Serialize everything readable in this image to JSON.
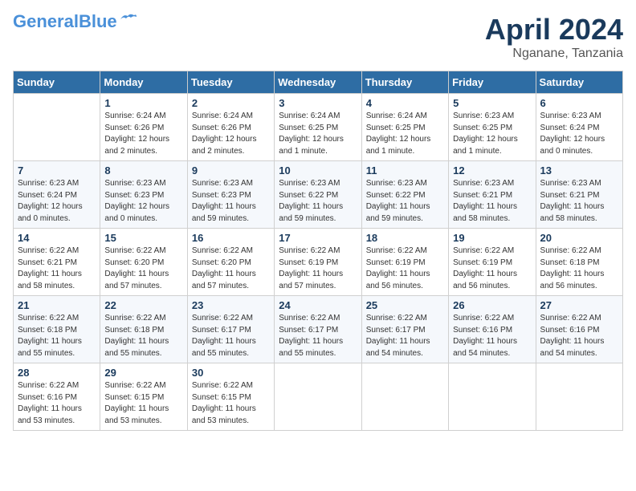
{
  "logo": {
    "line1": "General",
    "line2": "Blue"
  },
  "header": {
    "month": "April 2024",
    "location": "Nganane, Tanzania"
  },
  "weekdays": [
    "Sunday",
    "Monday",
    "Tuesday",
    "Wednesday",
    "Thursday",
    "Friday",
    "Saturday"
  ],
  "weeks": [
    [
      {
        "day": "",
        "info": ""
      },
      {
        "day": "1",
        "info": "Sunrise: 6:24 AM\nSunset: 6:26 PM\nDaylight: 12 hours\nand 2 minutes."
      },
      {
        "day": "2",
        "info": "Sunrise: 6:24 AM\nSunset: 6:26 PM\nDaylight: 12 hours\nand 2 minutes."
      },
      {
        "day": "3",
        "info": "Sunrise: 6:24 AM\nSunset: 6:25 PM\nDaylight: 12 hours\nand 1 minute."
      },
      {
        "day": "4",
        "info": "Sunrise: 6:24 AM\nSunset: 6:25 PM\nDaylight: 12 hours\nand 1 minute."
      },
      {
        "day": "5",
        "info": "Sunrise: 6:23 AM\nSunset: 6:25 PM\nDaylight: 12 hours\nand 1 minute."
      },
      {
        "day": "6",
        "info": "Sunrise: 6:23 AM\nSunset: 6:24 PM\nDaylight: 12 hours\nand 0 minutes."
      }
    ],
    [
      {
        "day": "7",
        "info": "Sunrise: 6:23 AM\nSunset: 6:24 PM\nDaylight: 12 hours\nand 0 minutes."
      },
      {
        "day": "8",
        "info": "Sunrise: 6:23 AM\nSunset: 6:23 PM\nDaylight: 12 hours\nand 0 minutes."
      },
      {
        "day": "9",
        "info": "Sunrise: 6:23 AM\nSunset: 6:23 PM\nDaylight: 11 hours\nand 59 minutes."
      },
      {
        "day": "10",
        "info": "Sunrise: 6:23 AM\nSunset: 6:22 PM\nDaylight: 11 hours\nand 59 minutes."
      },
      {
        "day": "11",
        "info": "Sunrise: 6:23 AM\nSunset: 6:22 PM\nDaylight: 11 hours\nand 59 minutes."
      },
      {
        "day": "12",
        "info": "Sunrise: 6:23 AM\nSunset: 6:21 PM\nDaylight: 11 hours\nand 58 minutes."
      },
      {
        "day": "13",
        "info": "Sunrise: 6:23 AM\nSunset: 6:21 PM\nDaylight: 11 hours\nand 58 minutes."
      }
    ],
    [
      {
        "day": "14",
        "info": "Sunrise: 6:22 AM\nSunset: 6:21 PM\nDaylight: 11 hours\nand 58 minutes."
      },
      {
        "day": "15",
        "info": "Sunrise: 6:22 AM\nSunset: 6:20 PM\nDaylight: 11 hours\nand 57 minutes."
      },
      {
        "day": "16",
        "info": "Sunrise: 6:22 AM\nSunset: 6:20 PM\nDaylight: 11 hours\nand 57 minutes."
      },
      {
        "day": "17",
        "info": "Sunrise: 6:22 AM\nSunset: 6:19 PM\nDaylight: 11 hours\nand 57 minutes."
      },
      {
        "day": "18",
        "info": "Sunrise: 6:22 AM\nSunset: 6:19 PM\nDaylight: 11 hours\nand 56 minutes."
      },
      {
        "day": "19",
        "info": "Sunrise: 6:22 AM\nSunset: 6:19 PM\nDaylight: 11 hours\nand 56 minutes."
      },
      {
        "day": "20",
        "info": "Sunrise: 6:22 AM\nSunset: 6:18 PM\nDaylight: 11 hours\nand 56 minutes."
      }
    ],
    [
      {
        "day": "21",
        "info": "Sunrise: 6:22 AM\nSunset: 6:18 PM\nDaylight: 11 hours\nand 55 minutes."
      },
      {
        "day": "22",
        "info": "Sunrise: 6:22 AM\nSunset: 6:18 PM\nDaylight: 11 hours\nand 55 minutes."
      },
      {
        "day": "23",
        "info": "Sunrise: 6:22 AM\nSunset: 6:17 PM\nDaylight: 11 hours\nand 55 minutes."
      },
      {
        "day": "24",
        "info": "Sunrise: 6:22 AM\nSunset: 6:17 PM\nDaylight: 11 hours\nand 55 minutes."
      },
      {
        "day": "25",
        "info": "Sunrise: 6:22 AM\nSunset: 6:17 PM\nDaylight: 11 hours\nand 54 minutes."
      },
      {
        "day": "26",
        "info": "Sunrise: 6:22 AM\nSunset: 6:16 PM\nDaylight: 11 hours\nand 54 minutes."
      },
      {
        "day": "27",
        "info": "Sunrise: 6:22 AM\nSunset: 6:16 PM\nDaylight: 11 hours\nand 54 minutes."
      }
    ],
    [
      {
        "day": "28",
        "info": "Sunrise: 6:22 AM\nSunset: 6:16 PM\nDaylight: 11 hours\nand 53 minutes."
      },
      {
        "day": "29",
        "info": "Sunrise: 6:22 AM\nSunset: 6:15 PM\nDaylight: 11 hours\nand 53 minutes."
      },
      {
        "day": "30",
        "info": "Sunrise: 6:22 AM\nSunset: 6:15 PM\nDaylight: 11 hours\nand 53 minutes."
      },
      {
        "day": "",
        "info": ""
      },
      {
        "day": "",
        "info": ""
      },
      {
        "day": "",
        "info": ""
      },
      {
        "day": "",
        "info": ""
      }
    ]
  ]
}
